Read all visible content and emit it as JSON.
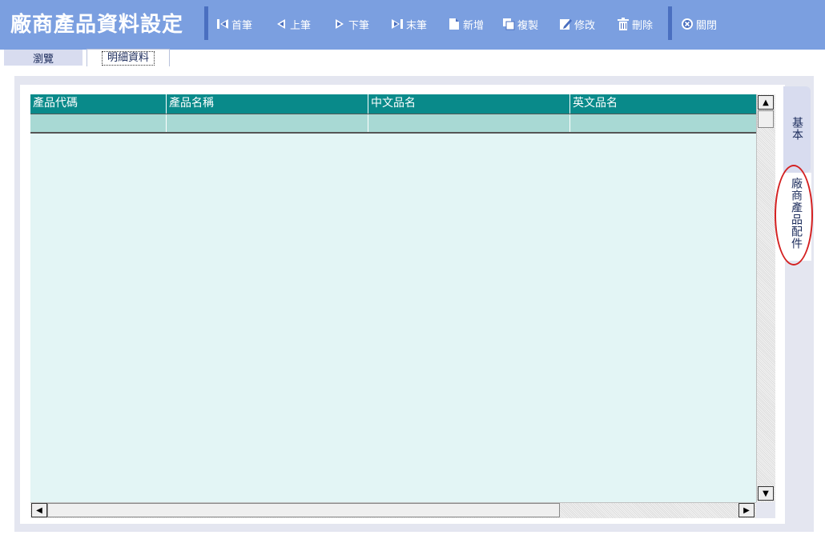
{
  "header": {
    "title": "廠商產品資料設定",
    "background_color": "#7b9fe0"
  },
  "toolbar": {
    "first_label": "首筆",
    "prev_label": "上筆",
    "next_label": "下筆",
    "last_label": "末筆",
    "new_label": "新增",
    "copy_label": "複製",
    "edit_label": "修改",
    "delete_label": "刪除",
    "close_label": "關閉"
  },
  "tabs": [
    {
      "label": "瀏覽",
      "active": false
    },
    {
      "label": "明細資料",
      "active": true
    }
  ],
  "grid": {
    "header_color": "#098a8a",
    "columns": [
      "產品代碼",
      "產品名稱",
      "中文品名",
      "英文品名"
    ],
    "rows": [
      [
        "",
        "",
        "",
        ""
      ]
    ]
  },
  "side_tabs": [
    {
      "label": "基本",
      "active": false
    },
    {
      "label": "廠商產品配件",
      "active": true
    }
  ],
  "colors": {
    "grid_background": "#e3f5f5",
    "selected_row": "#a8d9d4",
    "highlight_ring": "#d42020"
  }
}
